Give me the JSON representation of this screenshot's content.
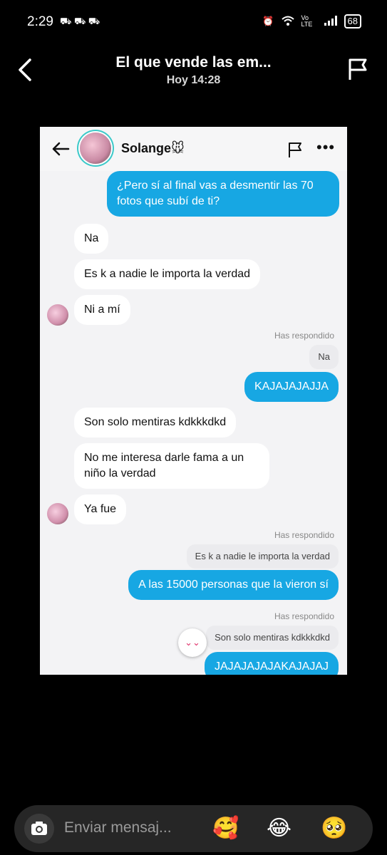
{
  "status": {
    "time": "2:29",
    "notif_icons": "⛟ ⛟ ⛟",
    "battery": "68",
    "network": "Vo LTE"
  },
  "header": {
    "title": "El que vende las em...",
    "subtitle": "Hoy 14:28"
  },
  "shot": {
    "contact_name": "Solange🐭",
    "messages": [
      {
        "text": "¿Pero sí al final vas a desmentir las 70 fotos que subí de ti?"
      },
      {
        "text": "Na"
      },
      {
        "text": "Es k a nadie le importa la verdad"
      },
      {
        "text": "Ni a mí"
      },
      {
        "text": "Has respondido"
      },
      {
        "text": "Na"
      },
      {
        "text": "KAJAJAJAJJA"
      },
      {
        "text": "Son solo mentiras kdkkkdkd"
      },
      {
        "text": "No me interesa darle fama a un niño la verdad"
      },
      {
        "text": "Ya fue"
      },
      {
        "text": "Has respondido"
      },
      {
        "text": "Es k a nadie le importa la verdad"
      },
      {
        "text": "A las 15000 personas que la vieron sí"
      },
      {
        "text": "Has respondido"
      },
      {
        "text": "Son solo mentiras kdkkkdkd"
      },
      {
        "text": "JAJAJAJAJAKAJAJAJ"
      }
    ]
  },
  "composer": {
    "placeholder": "Enviar mensaj...",
    "emojis": [
      "🥰",
      "😂",
      "🥺"
    ]
  },
  "colors": {
    "outgoing": "#17a7e3",
    "incoming": "#ffffff"
  }
}
